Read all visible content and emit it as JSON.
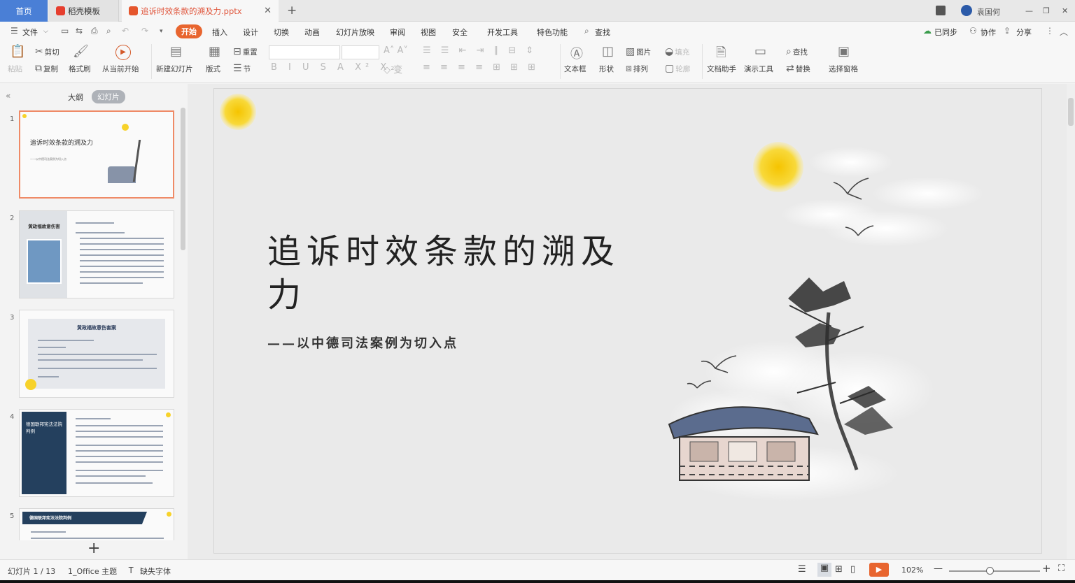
{
  "tabs": {
    "home": "首页",
    "template": "稻壳模板",
    "document": "追诉时效条款的溯及力.pptx",
    "user": "袁国何"
  },
  "menu": {
    "file": "文件",
    "items": [
      "开始",
      "插入",
      "设计",
      "切换",
      "动画",
      "幻灯片放映",
      "审阅",
      "视图",
      "安全",
      "开发工具",
      "特色功能"
    ],
    "search": "查找",
    "sync": "已同步",
    "collab": "协作",
    "share": "分享"
  },
  "toolbar": {
    "paste": "粘贴",
    "cut": "剪切",
    "copy": "复制",
    "format_painter": "格式刷",
    "from_current": "从当前开始",
    "new_slide": "新建幻灯片",
    "layout": "版式",
    "reset": "重置",
    "section": "节",
    "textbox": "文本框",
    "shape": "形状",
    "picture": "图片",
    "fill": "填充",
    "arrange": "排列",
    "outline": "轮廓",
    "doc_assistant": "文档助手",
    "presentation_tools": "演示工具",
    "find": "查找",
    "replace": "替换",
    "selection_pane": "选择窗格"
  },
  "leftpanel": {
    "outline_tab": "大纲",
    "slides_tab": "幻灯片",
    "add_button": "+"
  },
  "thumbnails": [
    {
      "num": "1",
      "title": "追诉时效条款的溯及力",
      "subtitle": "——以中德司法案例为切入点"
    },
    {
      "num": "2",
      "title": "黄政福故意伤害",
      "subtitle": ""
    },
    {
      "num": "3",
      "title": "黄政福故意伤害案",
      "subtitle": ""
    },
    {
      "num": "4",
      "title": "德国联邦宪法法院判例",
      "subtitle": ""
    },
    {
      "num": "5",
      "title": "德国联邦宪法法院判例",
      "subtitle": ""
    }
  ],
  "slide": {
    "title": "追诉时效条款的溯及力",
    "subtitle": "——以中德司法案例为切入点"
  },
  "status": {
    "slide_counter": "幻灯片 1 / 13",
    "theme": "1_Office 主题",
    "missing_font": "缺失字体",
    "zoom": "102%",
    "zoom_fraction": 0.45
  },
  "colors": {
    "accent": "#e8652f",
    "home_tab": "#4a7fd6",
    "sun": "#f7d22a",
    "panel_dark": "#24405e"
  }
}
